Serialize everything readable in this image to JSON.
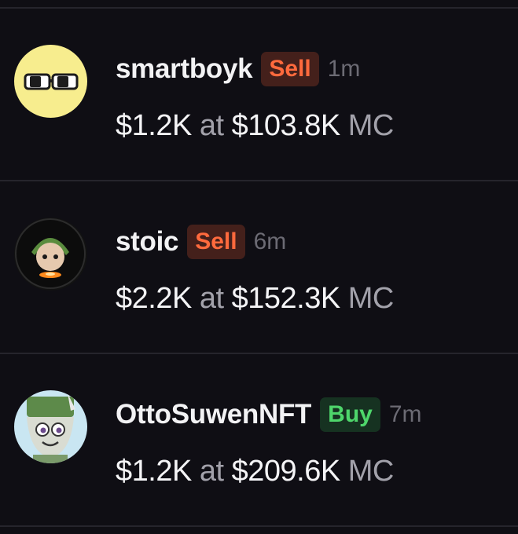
{
  "trades": [
    {
      "username": "smartboyk",
      "side": "Sell",
      "time": "1m",
      "amount": "$1.2K",
      "at_label": "at",
      "market_cap": "$103.8K",
      "mc_label": "MC"
    },
    {
      "username": "stoic",
      "side": "Sell",
      "time": "6m",
      "amount": "$2.2K",
      "at_label": "at",
      "market_cap": "$152.3K",
      "mc_label": "MC"
    },
    {
      "username": "OttoSuwenNFT",
      "side": "Buy",
      "time": "7m",
      "amount": "$1.2K",
      "at_label": "at",
      "market_cap": "$209.6K",
      "mc_label": "MC"
    }
  ],
  "colors": {
    "background": "#0f0e14",
    "sell_text": "#ff6a3d",
    "sell_bg": "#44201b",
    "buy_text": "#4ed66b",
    "buy_bg": "#163221"
  }
}
